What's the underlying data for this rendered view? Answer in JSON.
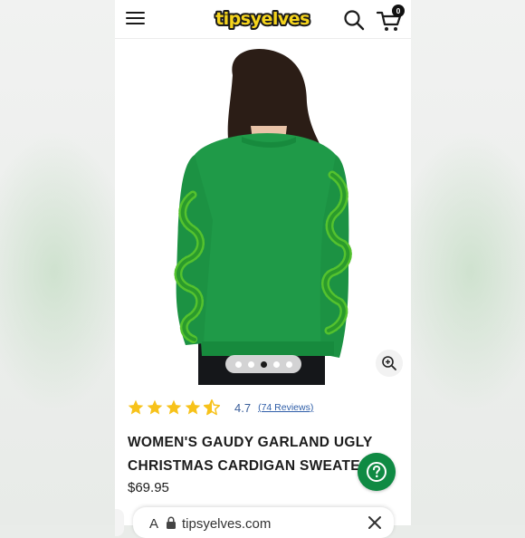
{
  "header": {
    "logo_text": "tipsyelves",
    "cart_count": "0",
    "icons": [
      "menu-icon",
      "search-icon",
      "cart-icon"
    ]
  },
  "gallery": {
    "image_alt": "Women's Gaudy Garland Ugly Christmas Cardigan Sweater - back view",
    "total_images": 5,
    "active_index": 2
  },
  "product": {
    "rating": 4.7,
    "rating_text": "4.7",
    "reviews_text": "(74 Reviews)",
    "title_line1": "WOMEN'S GAUDY GARLAND UGLY",
    "title_line2": "CHRISTMAS CARDIGAN SWEATE",
    "price": "$69.95"
  },
  "browser_bar": {
    "aa_text": "A",
    "url_text": "tipsyelves.com"
  },
  "colors": {
    "brand_green": "#0f8a43",
    "star_yellow": "#f7c21a",
    "link_blue": "#2f5ea8",
    "sweater_green": "#1f9a48",
    "logo_yellow": "#f5d41d"
  }
}
